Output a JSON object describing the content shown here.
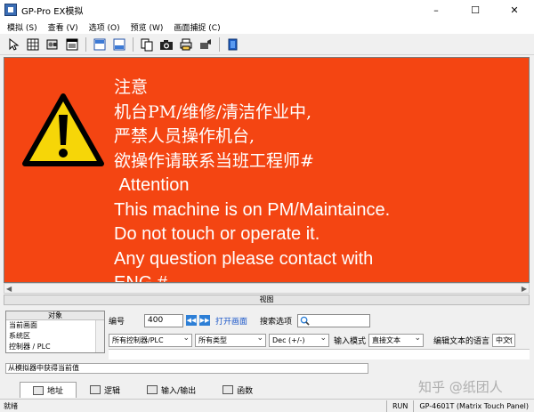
{
  "window": {
    "title": "GP-Pro EX模拟",
    "controls": [
      "–",
      "☐",
      "✕"
    ]
  },
  "menu": [
    "模拟 (S)",
    "查看 (V)",
    "选项 (O)",
    "预览 (W)",
    "画面捕捉 (C)"
  ],
  "toolbar_icons": [
    "pointer-icon",
    "grid-icon",
    "tools-icon",
    "window-icon",
    "panel-h-icon",
    "panel-v-icon",
    "copy-icon",
    "camera-icon",
    "print-icon",
    "settings-icon",
    "exit-icon"
  ],
  "screen": {
    "bg_color": "#f44512",
    "lines": [
      "注意",
      "机台PM/维修/清洁作业中,",
      "严禁人员操作机台,",
      "欲操作请联系当班工程师#",
      " Attention",
      "This machine is on PM/Maintaince.",
      "Do not touch or operate it.",
      "Any question please contact with",
      "ENG #"
    ]
  },
  "view_panel": {
    "title": "视图",
    "object_panel": {
      "title": "对象",
      "items": [
        "当前画面",
        "系统区",
        "控制器 / PLC"
      ]
    },
    "number_label": "编号",
    "number_value": "400",
    "open_screen_link": "打开画面",
    "search_option_label": "搜索选项",
    "dropdowns": [
      "所有控制器/PLC",
      "所有类型",
      "Dec (+/-)"
    ],
    "input_mode_label": "输入模式",
    "input_mode_value": "直接文本",
    "edit_lang_label": "编辑文本的语言",
    "edit_lang_value": "中文(",
    "status_message": "从模拟器中获得当前值"
  },
  "tabs": [
    "地址",
    "逻辑",
    "输入/输出",
    "函数"
  ],
  "statusbar": {
    "left": "就绪",
    "mode": "RUN",
    "model": "GP-4601T (Matrix Touch Panel)"
  },
  "watermark": "知乎 @纸团人"
}
